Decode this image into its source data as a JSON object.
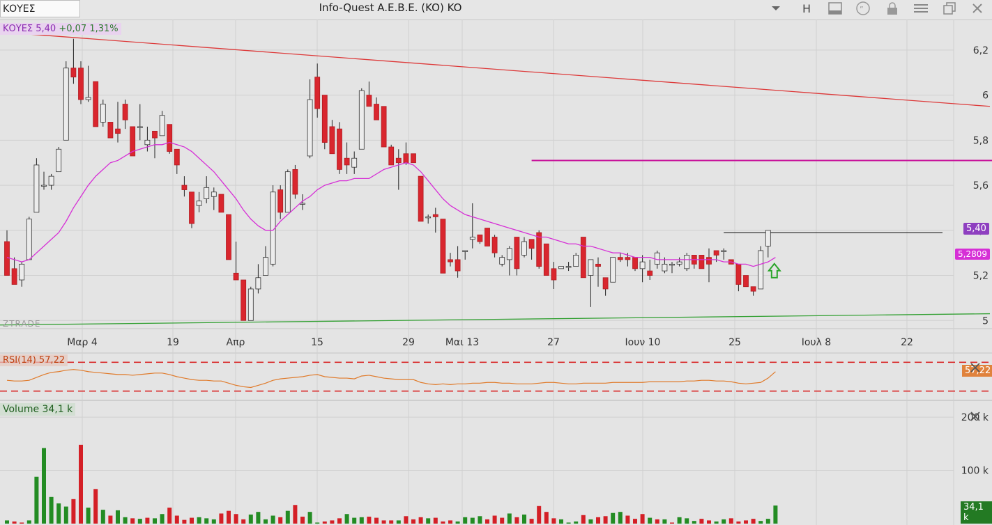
{
  "toolbar": {
    "symbol_value": "ΚΟΥΕΣ",
    "title": "Info-Quest  A.E.B.E. (KO) KO",
    "h_label": "H",
    "icons": [
      "chevron-down-icon",
      "panel-icon",
      "quote-icon",
      "lock-icon",
      "menu-icon",
      "restore-window-icon",
      "close-icon"
    ]
  },
  "price_panel": {
    "label_symbol": "ΚΟΥΕΣ 5,40",
    "label_change": "+0,07 1,31%",
    "watermark": "ZTRADE",
    "last_price_badge": "5,40",
    "ma_badge": "5,2809",
    "colors": {
      "up": "#e8e8e8",
      "down": "#d9262e",
      "ma": "#d62fd6",
      "resistance": "#d9262e",
      "support": "#2e9e2e",
      "level": "#c8149b"
    }
  },
  "rsi_panel": {
    "label": "RSI(14)  57,22",
    "badge": "57,22"
  },
  "volume_panel": {
    "label": "Volume  34,1 k",
    "badge": "34,1 k"
  },
  "x_axis_labels": [
    "Μαρ 4",
    "19",
    "Απρ",
    "15",
    "29",
    "Μαι 13",
    "27",
    "Ιουν 10",
    "25",
    "Ιουλ 8",
    "22"
  ],
  "chart_data": {
    "type": "candlestick",
    "title": "Info-Quest  A.E.B.E. (KO) KO",
    "ylim": [
      4.97,
      6.32
    ],
    "y_ticks": [
      "6,2",
      "6",
      "5,8",
      "5,6",
      "5,4",
      "5,2",
      "5"
    ],
    "y_tick_values": [
      6.2,
      6.0,
      5.8,
      5.6,
      5.4,
      5.2,
      5.0
    ],
    "candles": [
      {
        "o": 5.35,
        "h": 5.4,
        "l": 5.2,
        "c": 5.2
      },
      {
        "o": 5.23,
        "h": 5.28,
        "l": 5.16,
        "c": 5.16
      },
      {
        "o": 5.18,
        "h": 5.26,
        "l": 5.15,
        "c": 5.25
      },
      {
        "o": 5.27,
        "h": 5.46,
        "l": 5.27,
        "c": 5.45
      },
      {
        "o": 5.48,
        "h": 5.72,
        "l": 5.48,
        "c": 5.69
      },
      {
        "o": 5.6,
        "h": 5.66,
        "l": 5.58,
        "c": 5.6
      },
      {
        "o": 5.6,
        "h": 5.65,
        "l": 5.58,
        "c": 5.64
      },
      {
        "o": 5.66,
        "h": 5.77,
        "l": 5.66,
        "c": 5.76
      },
      {
        "o": 5.8,
        "h": 6.15,
        "l": 5.8,
        "c": 6.12
      },
      {
        "o": 6.12,
        "h": 6.25,
        "l": 6.05,
        "c": 6.08
      },
      {
        "o": 6.12,
        "h": 6.15,
        "l": 5.96,
        "c": 5.98
      },
      {
        "o": 5.98,
        "h": 6.13,
        "l": 5.97,
        "c": 5.99
      },
      {
        "o": 6.06,
        "h": 6.06,
        "l": 5.86,
        "c": 5.86
      },
      {
        "o": 5.88,
        "h": 5.98,
        "l": 5.86,
        "c": 5.96
      },
      {
        "o": 5.88,
        "h": 5.88,
        "l": 5.81,
        "c": 5.81
      },
      {
        "o": 5.85,
        "h": 5.97,
        "l": 5.79,
        "c": 5.83
      },
      {
        "o": 5.96,
        "h": 5.98,
        "l": 5.85,
        "c": 5.89
      },
      {
        "o": 5.86,
        "h": 5.86,
        "l": 5.73,
        "c": 5.73
      },
      {
        "o": 5.86,
        "h": 5.96,
        "l": 5.8,
        "c": 5.86
      },
      {
        "o": 5.78,
        "h": 5.86,
        "l": 5.75,
        "c": 5.8
      },
      {
        "o": 5.84,
        "h": 5.84,
        "l": 5.72,
        "c": 5.81
      },
      {
        "o": 5.82,
        "h": 5.93,
        "l": 5.82,
        "c": 5.91
      },
      {
        "o": 5.87,
        "h": 5.87,
        "l": 5.74,
        "c": 5.75
      },
      {
        "o": 5.76,
        "h": 5.76,
        "l": 5.65,
        "c": 5.69
      },
      {
        "o": 5.6,
        "h": 5.64,
        "l": 5.55,
        "c": 5.58
      },
      {
        "o": 5.57,
        "h": 5.57,
        "l": 5.41,
        "c": 5.43
      },
      {
        "o": 5.51,
        "h": 5.57,
        "l": 5.48,
        "c": 5.53
      },
      {
        "o": 5.54,
        "h": 5.64,
        "l": 5.52,
        "c": 5.59
      },
      {
        "o": 5.55,
        "h": 5.59,
        "l": 5.49,
        "c": 5.57
      },
      {
        "o": 5.56,
        "h": 5.56,
        "l": 5.48,
        "c": 5.48
      },
      {
        "o": 5.47,
        "h": 5.47,
        "l": 5.27,
        "c": 5.27
      },
      {
        "o": 5.21,
        "h": 5.35,
        "l": 5.18,
        "c": 5.18
      },
      {
        "o": 5.18,
        "h": 5.18,
        "l": 5.0,
        "c": 5.0
      },
      {
        "o": 5.0,
        "h": 5.15,
        "l": 5.0,
        "c": 5.14
      },
      {
        "o": 5.14,
        "h": 5.25,
        "l": 5.12,
        "c": 5.19
      },
      {
        "o": 5.2,
        "h": 5.33,
        "l": 5.2,
        "c": 5.28
      },
      {
        "o": 5.25,
        "h": 5.6,
        "l": 5.24,
        "c": 5.57
      },
      {
        "o": 5.58,
        "h": 5.6,
        "l": 5.45,
        "c": 5.48
      },
      {
        "o": 5.48,
        "h": 5.67,
        "l": 5.48,
        "c": 5.66
      },
      {
        "o": 5.67,
        "h": 5.69,
        "l": 5.54,
        "c": 5.56
      },
      {
        "o": 5.52,
        "h": 5.56,
        "l": 5.49,
        "c": 5.52
      },
      {
        "o": 5.73,
        "h": 6.07,
        "l": 5.72,
        "c": 5.98
      },
      {
        "o": 6.08,
        "h": 6.14,
        "l": 5.9,
        "c": 5.94
      },
      {
        "o": 6.0,
        "h": 6.0,
        "l": 5.76,
        "c": 5.79
      },
      {
        "o": 5.86,
        "h": 5.89,
        "l": 5.74,
        "c": 5.74
      },
      {
        "o": 5.85,
        "h": 5.88,
        "l": 5.65,
        "c": 5.67
      },
      {
        "o": 5.72,
        "h": 5.79,
        "l": 5.65,
        "c": 5.69
      },
      {
        "o": 5.68,
        "h": 5.75,
        "l": 5.65,
        "c": 5.72
      },
      {
        "o": 5.76,
        "h": 6.03,
        "l": 5.76,
        "c": 6.02
      },
      {
        "o": 6.0,
        "h": 6.06,
        "l": 5.96,
        "c": 5.95
      },
      {
        "o": 5.96,
        "h": 5.99,
        "l": 5.91,
        "c": 5.89
      },
      {
        "o": 5.95,
        "h": 5.95,
        "l": 5.77,
        "c": 5.77
      },
      {
        "o": 5.77,
        "h": 5.78,
        "l": 5.69,
        "c": 5.69
      },
      {
        "o": 5.72,
        "h": 5.76,
        "l": 5.58,
        "c": 5.7
      },
      {
        "o": 5.74,
        "h": 5.79,
        "l": 5.69,
        "c": 5.7
      },
      {
        "o": 5.74,
        "h": 5.74,
        "l": 5.7,
        "c": 5.7
      },
      {
        "o": 5.64,
        "h": 5.64,
        "l": 5.44,
        "c": 5.44
      },
      {
        "o": 5.46,
        "h": 5.47,
        "l": 5.43,
        "c": 5.46
      },
      {
        "o": 5.47,
        "h": 5.5,
        "l": 5.39,
        "c": 5.46
      },
      {
        "o": 5.45,
        "h": 5.45,
        "l": 5.21,
        "c": 5.21
      },
      {
        "o": 5.27,
        "h": 5.3,
        "l": 5.24,
        "c": 5.26
      },
      {
        "o": 5.27,
        "h": 5.33,
        "l": 5.19,
        "c": 5.22
      },
      {
        "o": 5.31,
        "h": 5.31,
        "l": 5.27,
        "c": 5.31
      },
      {
        "o": 5.36,
        "h": 5.52,
        "l": 5.32,
        "c": 5.37
      },
      {
        "o": 5.38,
        "h": 5.38,
        "l": 5.34,
        "c": 5.35
      },
      {
        "o": 5.41,
        "h": 5.41,
        "l": 5.33,
        "c": 5.33
      },
      {
        "o": 5.37,
        "h": 5.38,
        "l": 5.28,
        "c": 5.3
      },
      {
        "o": 5.25,
        "h": 5.29,
        "l": 5.24,
        "c": 5.28
      },
      {
        "o": 5.27,
        "h": 5.33,
        "l": 5.2,
        "c": 5.32
      },
      {
        "o": 5.37,
        "h": 5.37,
        "l": 5.2,
        "c": 5.23
      },
      {
        "o": 5.29,
        "h": 5.37,
        "l": 5.28,
        "c": 5.35
      },
      {
        "o": 5.36,
        "h": 5.36,
        "l": 5.27,
        "c": 5.32
      },
      {
        "o": 5.39,
        "h": 5.4,
        "l": 5.23,
        "c": 5.24
      },
      {
        "o": 5.34,
        "h": 5.34,
        "l": 5.2,
        "c": 5.2
      },
      {
        "o": 5.23,
        "h": 5.26,
        "l": 5.14,
        "c": 5.18
      },
      {
        "o": 5.23,
        "h": 5.24,
        "l": 5.23,
        "c": 5.24
      },
      {
        "o": 5.24,
        "h": 5.26,
        "l": 5.22,
        "c": 5.24
      },
      {
        "o": 5.24,
        "h": 5.3,
        "l": 5.24,
        "c": 5.29
      },
      {
        "o": 5.37,
        "h": 5.37,
        "l": 5.19,
        "c": 5.19
      },
      {
        "o": 5.2,
        "h": 5.26,
        "l": 5.06,
        "c": 5.27
      },
      {
        "o": 5.25,
        "h": 5.28,
        "l": 5.15,
        "c": 5.24
      },
      {
        "o": 5.19,
        "h": 5.19,
        "l": 5.11,
        "c": 5.14
      },
      {
        "o": 5.17,
        "h": 5.28,
        "l": 5.17,
        "c": 5.28
      },
      {
        "o": 5.28,
        "h": 5.3,
        "l": 5.26,
        "c": 5.27
      },
      {
        "o": 5.28,
        "h": 5.3,
        "l": 5.24,
        "c": 5.27
      },
      {
        "o": 5.28,
        "h": 5.28,
        "l": 5.22,
        "c": 5.23
      },
      {
        "o": 5.23,
        "h": 5.29,
        "l": 5.17,
        "c": 5.26
      },
      {
        "o": 5.22,
        "h": 5.27,
        "l": 5.18,
        "c": 5.2
      },
      {
        "o": 5.25,
        "h": 5.31,
        "l": 5.23,
        "c": 5.3
      },
      {
        "o": 5.22,
        "h": 5.28,
        "l": 5.21,
        "c": 5.25
      },
      {
        "o": 5.25,
        "h": 5.26,
        "l": 5.21,
        "c": 5.25
      },
      {
        "o": 5.25,
        "h": 5.28,
        "l": 5.24,
        "c": 5.26
      },
      {
        "o": 5.23,
        "h": 5.3,
        "l": 5.22,
        "c": 5.29
      },
      {
        "o": 5.29,
        "h": 5.29,
        "l": 5.23,
        "c": 5.25
      },
      {
        "o": 5.29,
        "h": 5.29,
        "l": 5.23,
        "c": 5.23
      },
      {
        "o": 5.28,
        "h": 5.32,
        "l": 5.17,
        "c": 5.25
      },
      {
        "o": 5.31,
        "h": 5.31,
        "l": 5.26,
        "c": 5.29
      },
      {
        "o": 5.31,
        "h": 5.32,
        "l": 5.27,
        "c": 5.31
      },
      {
        "o": 5.27,
        "h": 5.27,
        "l": 5.25,
        "c": 5.25
      },
      {
        "o": 5.25,
        "h": 5.25,
        "l": 5.13,
        "c": 5.16
      },
      {
        "o": 5.2,
        "h": 5.2,
        "l": 5.15,
        "c": 5.15
      },
      {
        "o": 5.15,
        "h": 5.15,
        "l": 5.11,
        "c": 5.13
      },
      {
        "o": 5.14,
        "h": 5.33,
        "l": 5.14,
        "c": 5.31
      },
      {
        "o": 5.33,
        "h": 5.4,
        "l": 5.28,
        "c": 5.4
      }
    ],
    "ma": [
      5.28,
      5.27,
      5.26,
      5.27,
      5.3,
      5.33,
      5.36,
      5.39,
      5.44,
      5.5,
      5.55,
      5.6,
      5.64,
      5.67,
      5.7,
      5.71,
      5.73,
      5.75,
      5.76,
      5.77,
      5.78,
      5.78,
      5.79,
      5.78,
      5.77,
      5.75,
      5.72,
      5.69,
      5.66,
      5.62,
      5.58,
      5.54,
      5.49,
      5.45,
      5.42,
      5.4,
      5.4,
      5.44,
      5.47,
      5.5,
      5.53,
      5.55,
      5.58,
      5.6,
      5.61,
      5.62,
      5.62,
      5.63,
      5.63,
      5.63,
      5.65,
      5.67,
      5.68,
      5.69,
      5.7,
      5.69,
      5.66,
      5.62,
      5.58,
      5.54,
      5.51,
      5.49,
      5.47,
      5.46,
      5.45,
      5.44,
      5.43,
      5.42,
      5.41,
      5.4,
      5.39,
      5.38,
      5.37,
      5.37,
      5.36,
      5.35,
      5.34,
      5.34,
      5.33,
      5.33,
      5.32,
      5.31,
      5.3,
      5.3,
      5.29,
      5.28,
      5.28,
      5.28,
      5.27,
      5.27,
      5.27,
      5.27,
      5.27,
      5.27,
      5.27,
      5.27,
      5.27,
      5.26,
      5.26,
      5.25,
      5.25,
      5.24,
      5.25,
      5.26,
      5.28
    ],
    "resistance": {
      "start": 6.28,
      "end": 5.95
    },
    "support": {
      "start": 4.98,
      "end": 5.03
    },
    "horizontal_level": 5.71,
    "last_high_level": 5.39,
    "rsi": [
      45,
      44,
      44,
      45,
      49,
      53,
      56,
      57,
      59,
      60,
      59,
      57,
      56,
      55,
      54,
      53,
      53,
      52,
      53,
      54,
      55,
      55,
      53,
      50,
      48,
      46,
      45,
      45,
      44,
      44,
      41,
      38,
      36,
      35,
      38,
      41,
      45,
      47,
      48,
      49,
      50,
      52,
      53,
      50,
      49,
      48,
      48,
      47,
      51,
      52,
      50,
      48,
      47,
      46,
      46,
      46,
      42,
      40,
      39,
      40,
      39,
      40,
      40,
      41,
      41,
      42,
      42,
      41,
      41,
      40,
      40,
      40,
      41,
      42,
      42,
      41,
      40,
      40,
      41,
      41,
      41,
      41,
      42,
      42,
      42,
      42,
      42,
      43,
      43,
      43,
      43,
      43,
      44,
      44,
      45,
      45,
      44,
      44,
      43,
      41,
      40,
      41,
      42,
      48,
      57
    ],
    "rsi_levels": [
      70,
      30
    ],
    "volume_ticks": [
      "200 k",
      "100 k"
    ],
    "volume_tick_values": [
      200000,
      100000
    ],
    "volume_k": [
      6,
      4,
      2,
      6,
      88,
      142,
      50,
      38,
      32,
      46,
      148,
      30,
      65,
      26,
      15,
      25,
      12,
      10,
      9,
      11,
      10,
      18,
      30,
      15,
      7,
      11,
      12,
      10,
      8,
      19,
      24,
      18,
      8,
      17,
      22,
      8,
      15,
      12,
      24,
      35,
      13,
      22,
      2,
      4,
      6,
      10,
      18,
      11,
      12,
      13,
      11,
      6,
      6,
      6,
      14,
      8,
      12,
      10,
      11,
      4,
      6,
      4,
      12,
      11,
      14,
      8,
      15,
      11,
      19,
      12,
      17,
      9,
      33,
      22,
      10,
      8,
      2,
      4,
      16,
      8,
      12,
      14,
      20,
      22,
      15,
      9,
      18,
      11,
      8,
      8,
      2,
      12,
      10,
      5,
      9,
      6,
      4,
      8,
      10,
      4,
      6,
      9,
      5,
      9,
      34
    ],
    "volume_dir": [
      1,
      -1,
      -1,
      1,
      1,
      1,
      1,
      1,
      1,
      -1,
      -1,
      1,
      -1,
      1,
      -1,
      1,
      1,
      -1,
      1,
      -1,
      1,
      1,
      -1,
      -1,
      -1,
      -1,
      1,
      1,
      1,
      -1,
      -1,
      -1,
      -1,
      1,
      1,
      1,
      1,
      -1,
      1,
      -1,
      -1,
      1,
      1,
      -1,
      -1,
      -1,
      1,
      1,
      1,
      -1,
      -1,
      -1,
      -1,
      1,
      -1,
      -1,
      -1,
      1,
      -1,
      -1,
      -1,
      1,
      1,
      1,
      1,
      -1,
      -1,
      -1,
      1,
      -1,
      1,
      -1,
      -1,
      -1,
      -1,
      1,
      1,
      1,
      -1,
      1,
      -1,
      -1,
      1,
      1,
      -1,
      -1,
      -1,
      1,
      -1,
      1,
      -1,
      1,
      1,
      1,
      -1,
      -1,
      1,
      1,
      -1,
      -1,
      -1,
      -1,
      1,
      1,
      1
    ]
  }
}
